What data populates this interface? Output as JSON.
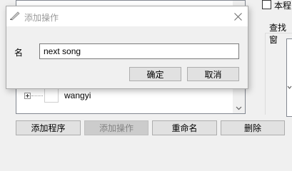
{
  "parent": {
    "tree": {
      "items": [
        {
          "label": "wangyi"
        }
      ]
    },
    "buttons": {
      "add_program": "添加程序",
      "add_action": "添加操作",
      "rename": "重命名",
      "delete": "删除"
    },
    "right": {
      "checkbox_label": "本程",
      "find_label": "查找窗"
    }
  },
  "dialog": {
    "title": "添加操作",
    "name_label": "名",
    "name_value": "next song",
    "ok_label": "确定",
    "cancel_label": "取消",
    "icons": {
      "title": "feather-pen-icon",
      "close": "close-icon"
    }
  }
}
